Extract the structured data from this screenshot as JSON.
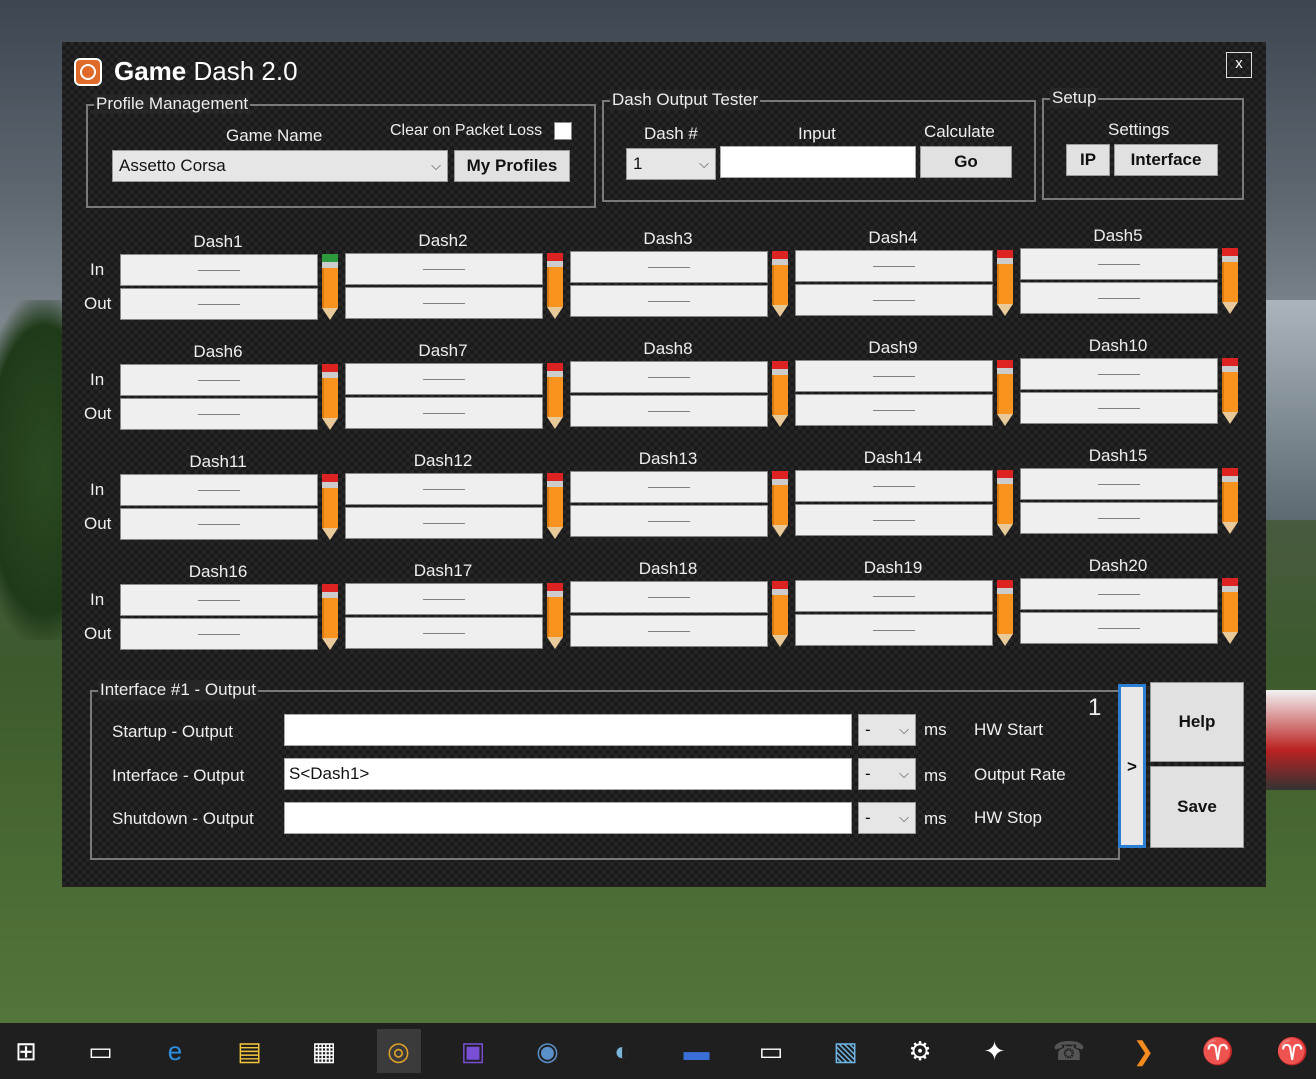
{
  "window": {
    "title_bold": "Game",
    "title_rest": " Dash 2.0",
    "close_label": "x"
  },
  "profile": {
    "group_title": "Profile Management",
    "game_name_label": "Game Name",
    "clear_label": "Clear on Packet Loss",
    "game_value": "Assetto Corsa",
    "my_profiles_label": "My Profiles"
  },
  "tester": {
    "group_title": "Dash Output Tester",
    "dash_num_label": "Dash #",
    "input_label": "Input",
    "calculate_label": "Calculate",
    "dash_value": "1",
    "go_label": "Go"
  },
  "setup": {
    "group_title": "Setup",
    "settings_label": "Settings",
    "ip_label": "IP",
    "interface_label": "Interface"
  },
  "dash_grid": {
    "in_label": "In",
    "out_label": "Out",
    "placeholder": "———",
    "dashes": [
      "Dash1",
      "Dash2",
      "Dash3",
      "Dash4",
      "Dash5",
      "Dash6",
      "Dash7",
      "Dash8",
      "Dash9",
      "Dash10",
      "Dash11",
      "Dash12",
      "Dash13",
      "Dash14",
      "Dash15",
      "Dash16",
      "Dash17",
      "Dash18",
      "Dash19",
      "Dash20"
    ]
  },
  "interface_output": {
    "group_title": "Interface #1 - Output",
    "number": "1",
    "startup_label": "Startup - Output",
    "interface_label": "Interface - Output",
    "shutdown_label": "Shutdown - Output",
    "startup_value": "",
    "interface_value": "S<Dash1>",
    "shutdown_value": "",
    "ms_select_value": "-",
    "ms_label": "ms",
    "hw_start_label": "HW Start",
    "output_rate_label": "Output Rate",
    "hw_stop_label": "HW Stop",
    "next_label": ">",
    "help_label": "Help",
    "save_label": "Save"
  },
  "taskbar": {
    "items": [
      "windows-start-icon",
      "task-view-icon",
      "edge-icon",
      "file-explorer-icon",
      "store-icon",
      "chrome-icon",
      "cpu-app-icon",
      "steam-icon",
      "teamspeak-icon",
      "car-app-icon",
      "oculus-icon",
      "settings-app-icon",
      "sim-racing-icon",
      "robot-app-icon",
      "phone-icon",
      "arrow-app-icon",
      "joystick-icon",
      "joystick-2-icon"
    ]
  },
  "colors": {
    "pencil_body": "#f7931e",
    "pencil_eraser": "#dd2222",
    "pencil_eraser_active": "#2e9a3e"
  }
}
